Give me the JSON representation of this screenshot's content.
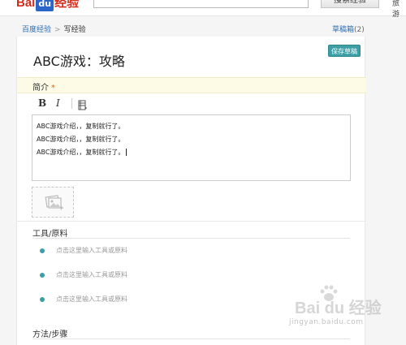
{
  "header": {
    "logo_baidu": "Bai",
    "logo_du": "du",
    "logo_jingyan": "经验",
    "search_value": "",
    "search_button": "搜索经验",
    "top_link": "旅游"
  },
  "breadcrumb": {
    "home": "百度经验",
    "separator": ">",
    "current": "写经验"
  },
  "drafts": {
    "label": "草稿箱",
    "count": "(2)"
  },
  "article": {
    "title": "ABC游戏：攻略",
    "save_label": "保存草稿"
  },
  "intro": {
    "label": "简介",
    "required_mark": "*",
    "toolbar": {
      "bold": "B",
      "italic": "I"
    },
    "lines": [
      "ABC游戏介绍，，复制就行了。",
      "ABC游戏介绍，，复制就行了。",
      "ABC游戏介绍，，复制就行了。"
    ]
  },
  "tools": {
    "title": "工具/原料",
    "items": [
      "点击这里输入工具或原料",
      "点击这里输入工具或原料",
      "点击这里输入工具或原料"
    ]
  },
  "steps": {
    "title": "方法/步骤"
  },
  "watermark": {
    "text": "Bai du 经验",
    "url": "jingyan.baidu.com"
  },
  "colors": {
    "accent": "#3d9ea5",
    "link": "#2a6db3",
    "brand_red": "#d42b1a",
    "intro_bg": "#fdfbe6"
  }
}
